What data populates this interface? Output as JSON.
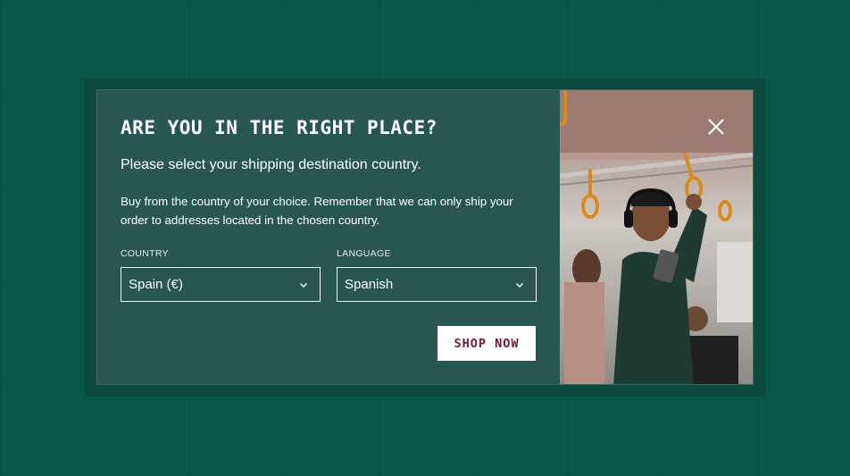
{
  "modal": {
    "title": "ARE YOU IN THE RIGHT PLACE?",
    "subtitle": "Please select your shipping destination country.",
    "description": "Buy from the country of your choice. Remember that we can only ship your order to addresses located in the chosen country.",
    "country": {
      "label": "COUNTRY",
      "value": "Spain (€)"
    },
    "language": {
      "label": "LANGUAGE",
      "value": "Spanish"
    },
    "shop_button": "SHOP NOW",
    "close_icon": "close-icon",
    "chevron_icon": "chevron-down-icon"
  },
  "colors": {
    "background": "#08584a",
    "modal": "#285650",
    "button_text": "#7a1537",
    "button_bg": "#ffffff"
  }
}
